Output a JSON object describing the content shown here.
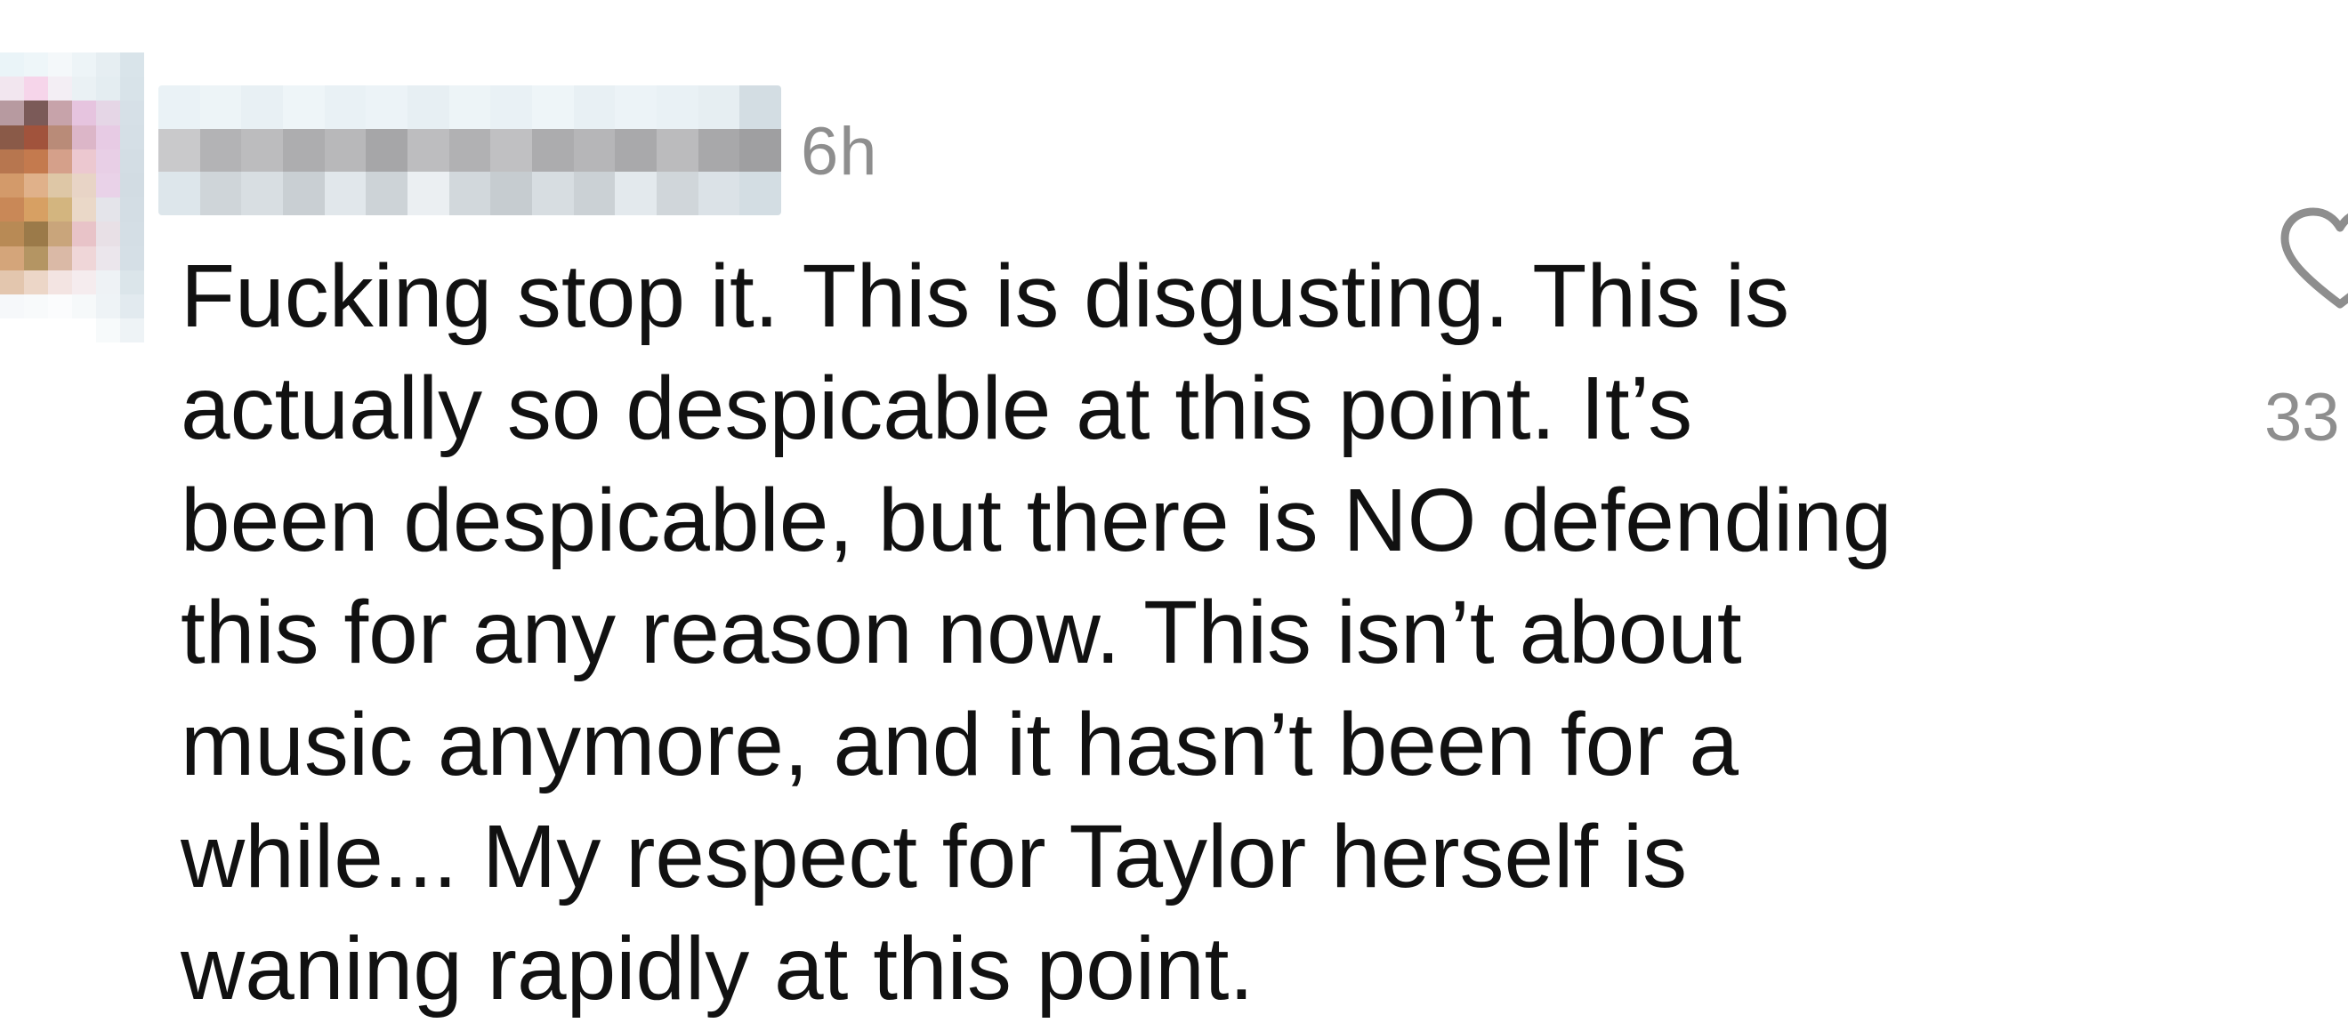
{
  "comment": {
    "author_avatar_icon": "avatar-pixelated",
    "author_name_icon": "username-pixelated",
    "timestamp": "6h",
    "text": "Fucking stop it. This is disgusting. This is\nactually so despicable at this point. It’s\nbeen despicable, but there is NO defending\nthis for any reason now. This isn’t about\nmusic anymore, and it hasn’t been for a\nwhile... My respect for Taylor herself is\nwaning rapidly at this point.",
    "like_icon": "heart-icon",
    "like_count": "33"
  }
}
